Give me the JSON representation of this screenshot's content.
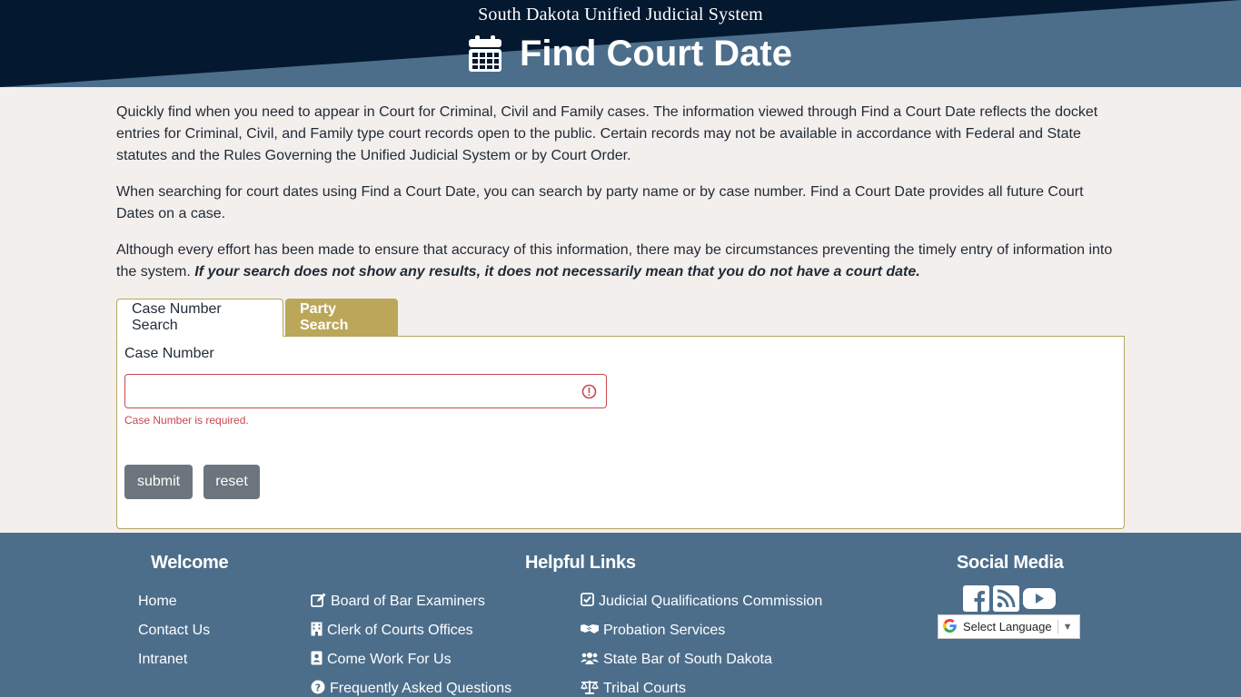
{
  "header": {
    "brand": "South Dakota Unified Judicial System",
    "title": "Find Court Date",
    "icon": "calendar-icon"
  },
  "intro": {
    "p1": "Quickly find when you need to appear in Court for Criminal, Civil and Family cases. The information viewed through Find a Court Date reflects the docket entries for Criminal, Civil, and Family type court records open to the public. Certain records may not be available in accordance with Federal and State statutes and the Rules Governing the Unified Judicial System or by Court Order.",
    "p2": "When searching for court dates using Find a Court Date, you can search by party name or by case number. Find a Court Date provides all future Court Dates on a case.",
    "p3": "Although every effort has been made to ensure that accuracy of this information, there may be circumstances preventing the timely entry of information into the system.",
    "p3_emphasis": "If your search does not show any results, it does not necessarily mean that you do not have a court date."
  },
  "tabs": [
    {
      "label": "Case Number Search",
      "active": true
    },
    {
      "label": "Party Search",
      "active": false
    }
  ],
  "form": {
    "case_number_label": "Case Number",
    "case_number_value": "",
    "case_number_placeholder": "",
    "error_message": "Case Number is required.",
    "submit_label": "submit",
    "reset_label": "reset"
  },
  "footer": {
    "welcome_heading": "Welcome",
    "helpful_heading": "Helpful Links",
    "social_heading": "Social Media",
    "welcome_links": [
      "Home",
      "Contact Us",
      "Intranet"
    ],
    "helpful_col1": [
      {
        "label": "Board of Bar Examiners",
        "icon": "edit-icon"
      },
      {
        "label": "Clerk of Courts Offices",
        "icon": "building-icon"
      },
      {
        "label": "Come Work For Us",
        "icon": "id-badge-icon"
      },
      {
        "label": "Frequently Asked Questions",
        "icon": "question-circle-icon"
      }
    ],
    "helpful_col2": [
      {
        "label": "Judicial Qualifications Commission",
        "icon": "check-square-icon"
      },
      {
        "label": "Probation Services",
        "icon": "handshake-icon"
      },
      {
        "label": "State Bar of South Dakota",
        "icon": "users-icon"
      },
      {
        "label": "Tribal Courts",
        "icon": "balance-scale-icon"
      }
    ],
    "social_icons": [
      "facebook-icon",
      "rss-icon",
      "youtube-icon"
    ],
    "language_select": "Select Language"
  },
  "colors": {
    "header_dark": "#04182f",
    "header_light": "#4c6e8b",
    "page_bg": "#f3efec",
    "tab_gold": "#bba75a",
    "error_red": "#c9474f",
    "button_gray": "#6c757d",
    "footer_bg": "#4c6e8b"
  }
}
